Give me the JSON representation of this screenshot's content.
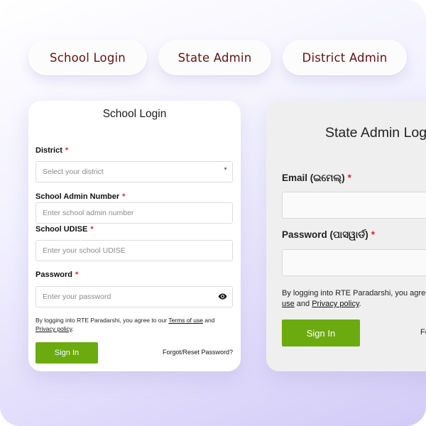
{
  "tabs": [
    {
      "label": "School Login"
    },
    {
      "label": "State Admin"
    },
    {
      "label": "District Admin"
    }
  ],
  "school_login": {
    "title": "School Login",
    "district": {
      "label": "District",
      "required": "*",
      "placeholder": "Select your district"
    },
    "admin_number": {
      "label": "School Admin Number",
      "required": "*",
      "placeholder": "Enter school admin number"
    },
    "udise": {
      "label": "School UDISE",
      "required": "*",
      "placeholder": "Enter your school UDISE"
    },
    "password": {
      "label": "Password",
      "required": "*",
      "placeholder": "Enter your password"
    },
    "agree_prefix": "By logging into RTE Paradarshi, you agree to our ",
    "terms": "Terms of use",
    "and": " and",
    "privacy": "Privacy policy",
    "period": ".",
    "sign_in": "Sign In",
    "forgot": "Forgot/Reset Password?"
  },
  "state_admin_login": {
    "title": "State Admin Log",
    "email_label": "Email (ଇମେଲ୍)",
    "required": "*",
    "password_label": "Password (ପାସୱାର୍ଡ)",
    "agree_line1": "By logging into RTE Paradarshi, you agree",
    "terms_fragment": "use",
    "and": " and ",
    "privacy": "Privacy policy",
    "period": ".",
    "sign_in": "Sign In",
    "forgot_fragment": "Fo"
  },
  "colors": {
    "accent_green": "#6bab0f",
    "tab_text": "#5e1313",
    "required": "#d0282e"
  }
}
